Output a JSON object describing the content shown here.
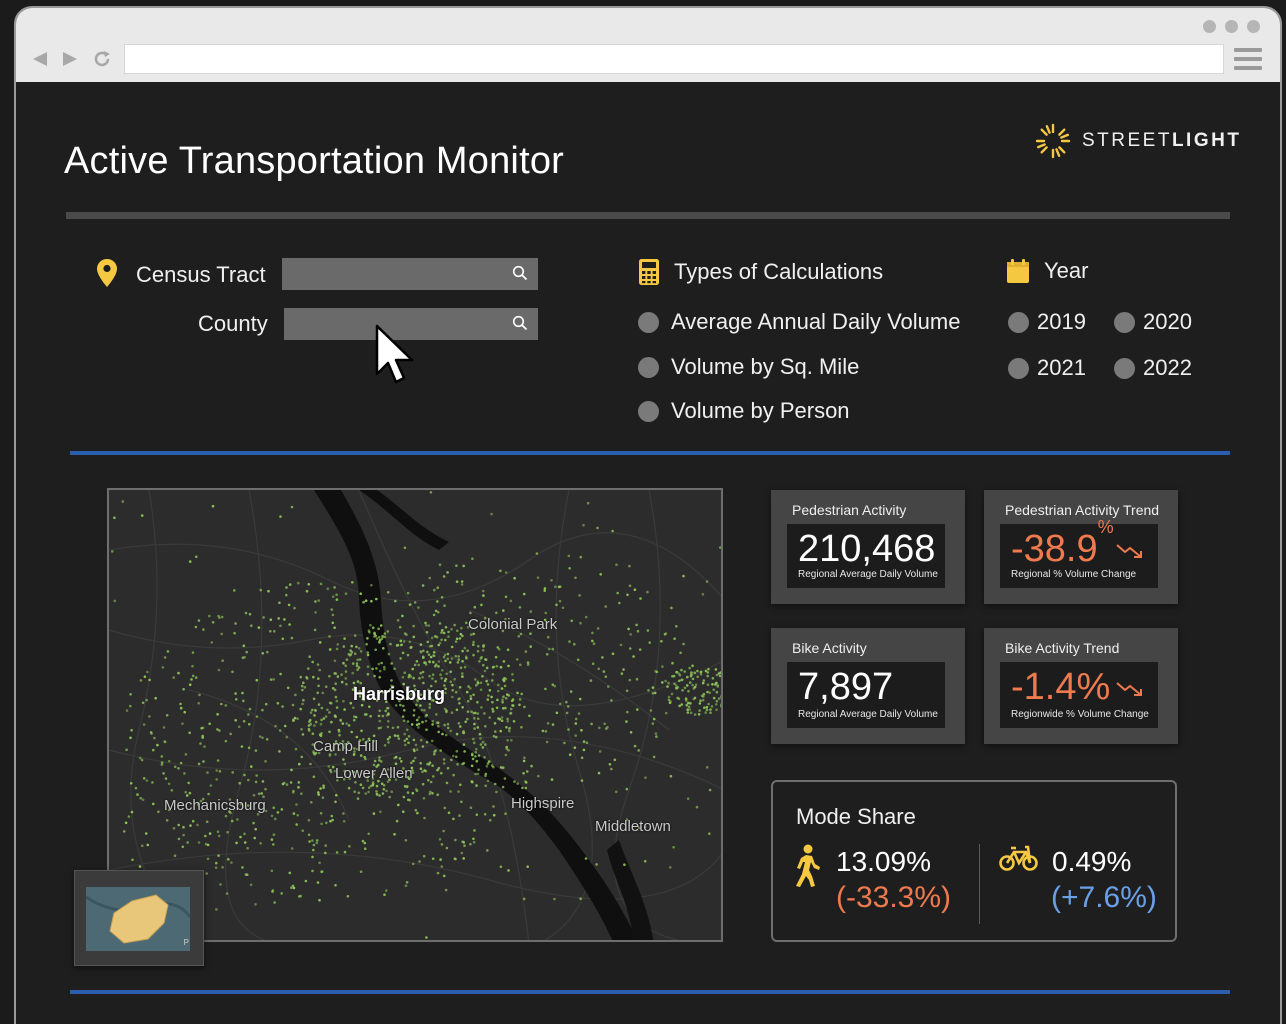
{
  "header": {
    "title": "Active Transportation Monitor",
    "brand_regular": "STREET",
    "brand_bold": "LIGHT"
  },
  "filters": {
    "census_tract_label": "Census Tract",
    "county_label": "County",
    "calc_header": "Types of Calculations",
    "calc_options": [
      "Average Annual Daily Volume",
      "Volume by Sq. Mile",
      "Volume by Person"
    ],
    "year_header": "Year",
    "years": [
      "2019",
      "2020",
      "2021",
      "2022"
    ]
  },
  "map": {
    "labels": [
      "Colonial Park",
      "Harrisburg",
      "Camp Hill",
      "Lower Allen",
      "Mechanicsburg",
      "Highspire",
      "Middletown"
    ],
    "inset_label": "P"
  },
  "cards": {
    "ped": {
      "title": "Pedestrian Activity",
      "value": "210,468",
      "sub": "Regional Average Daily Volume"
    },
    "ped_trend": {
      "title": "Pedestrian Activity Trend",
      "value": "-38.9",
      "unit": "%",
      "sub": "Regional % Volume Change"
    },
    "bike": {
      "title": "Bike Activity",
      "value": "7,897",
      "sub": "Regional Average Daily Volume"
    },
    "bike_trend": {
      "title": "Bike Activity Trend",
      "value": "-1.4%",
      "sub": "Regionwide % Volume Change"
    }
  },
  "mode_share": {
    "title": "Mode Share",
    "ped_value": "13.09%",
    "ped_change": "(-33.3%)",
    "bike_value": "0.49%",
    "bike_change": "(+7.6%)"
  },
  "colors": {
    "accent_yellow": "#f5c842",
    "negative_orange": "#ee7a4e",
    "positive_blue": "#6aa0e8",
    "divider_blue": "#2a5fb0",
    "map_dots": "#8fc45a"
  },
  "icons": [
    "back-icon",
    "forward-icon",
    "refresh-icon",
    "menu-icon",
    "map-pin-icon",
    "search-icon",
    "calculator-icon",
    "calendar-icon",
    "trend-down-icon",
    "pedestrian-icon",
    "bicycle-icon",
    "mouse-cursor-icon"
  ]
}
